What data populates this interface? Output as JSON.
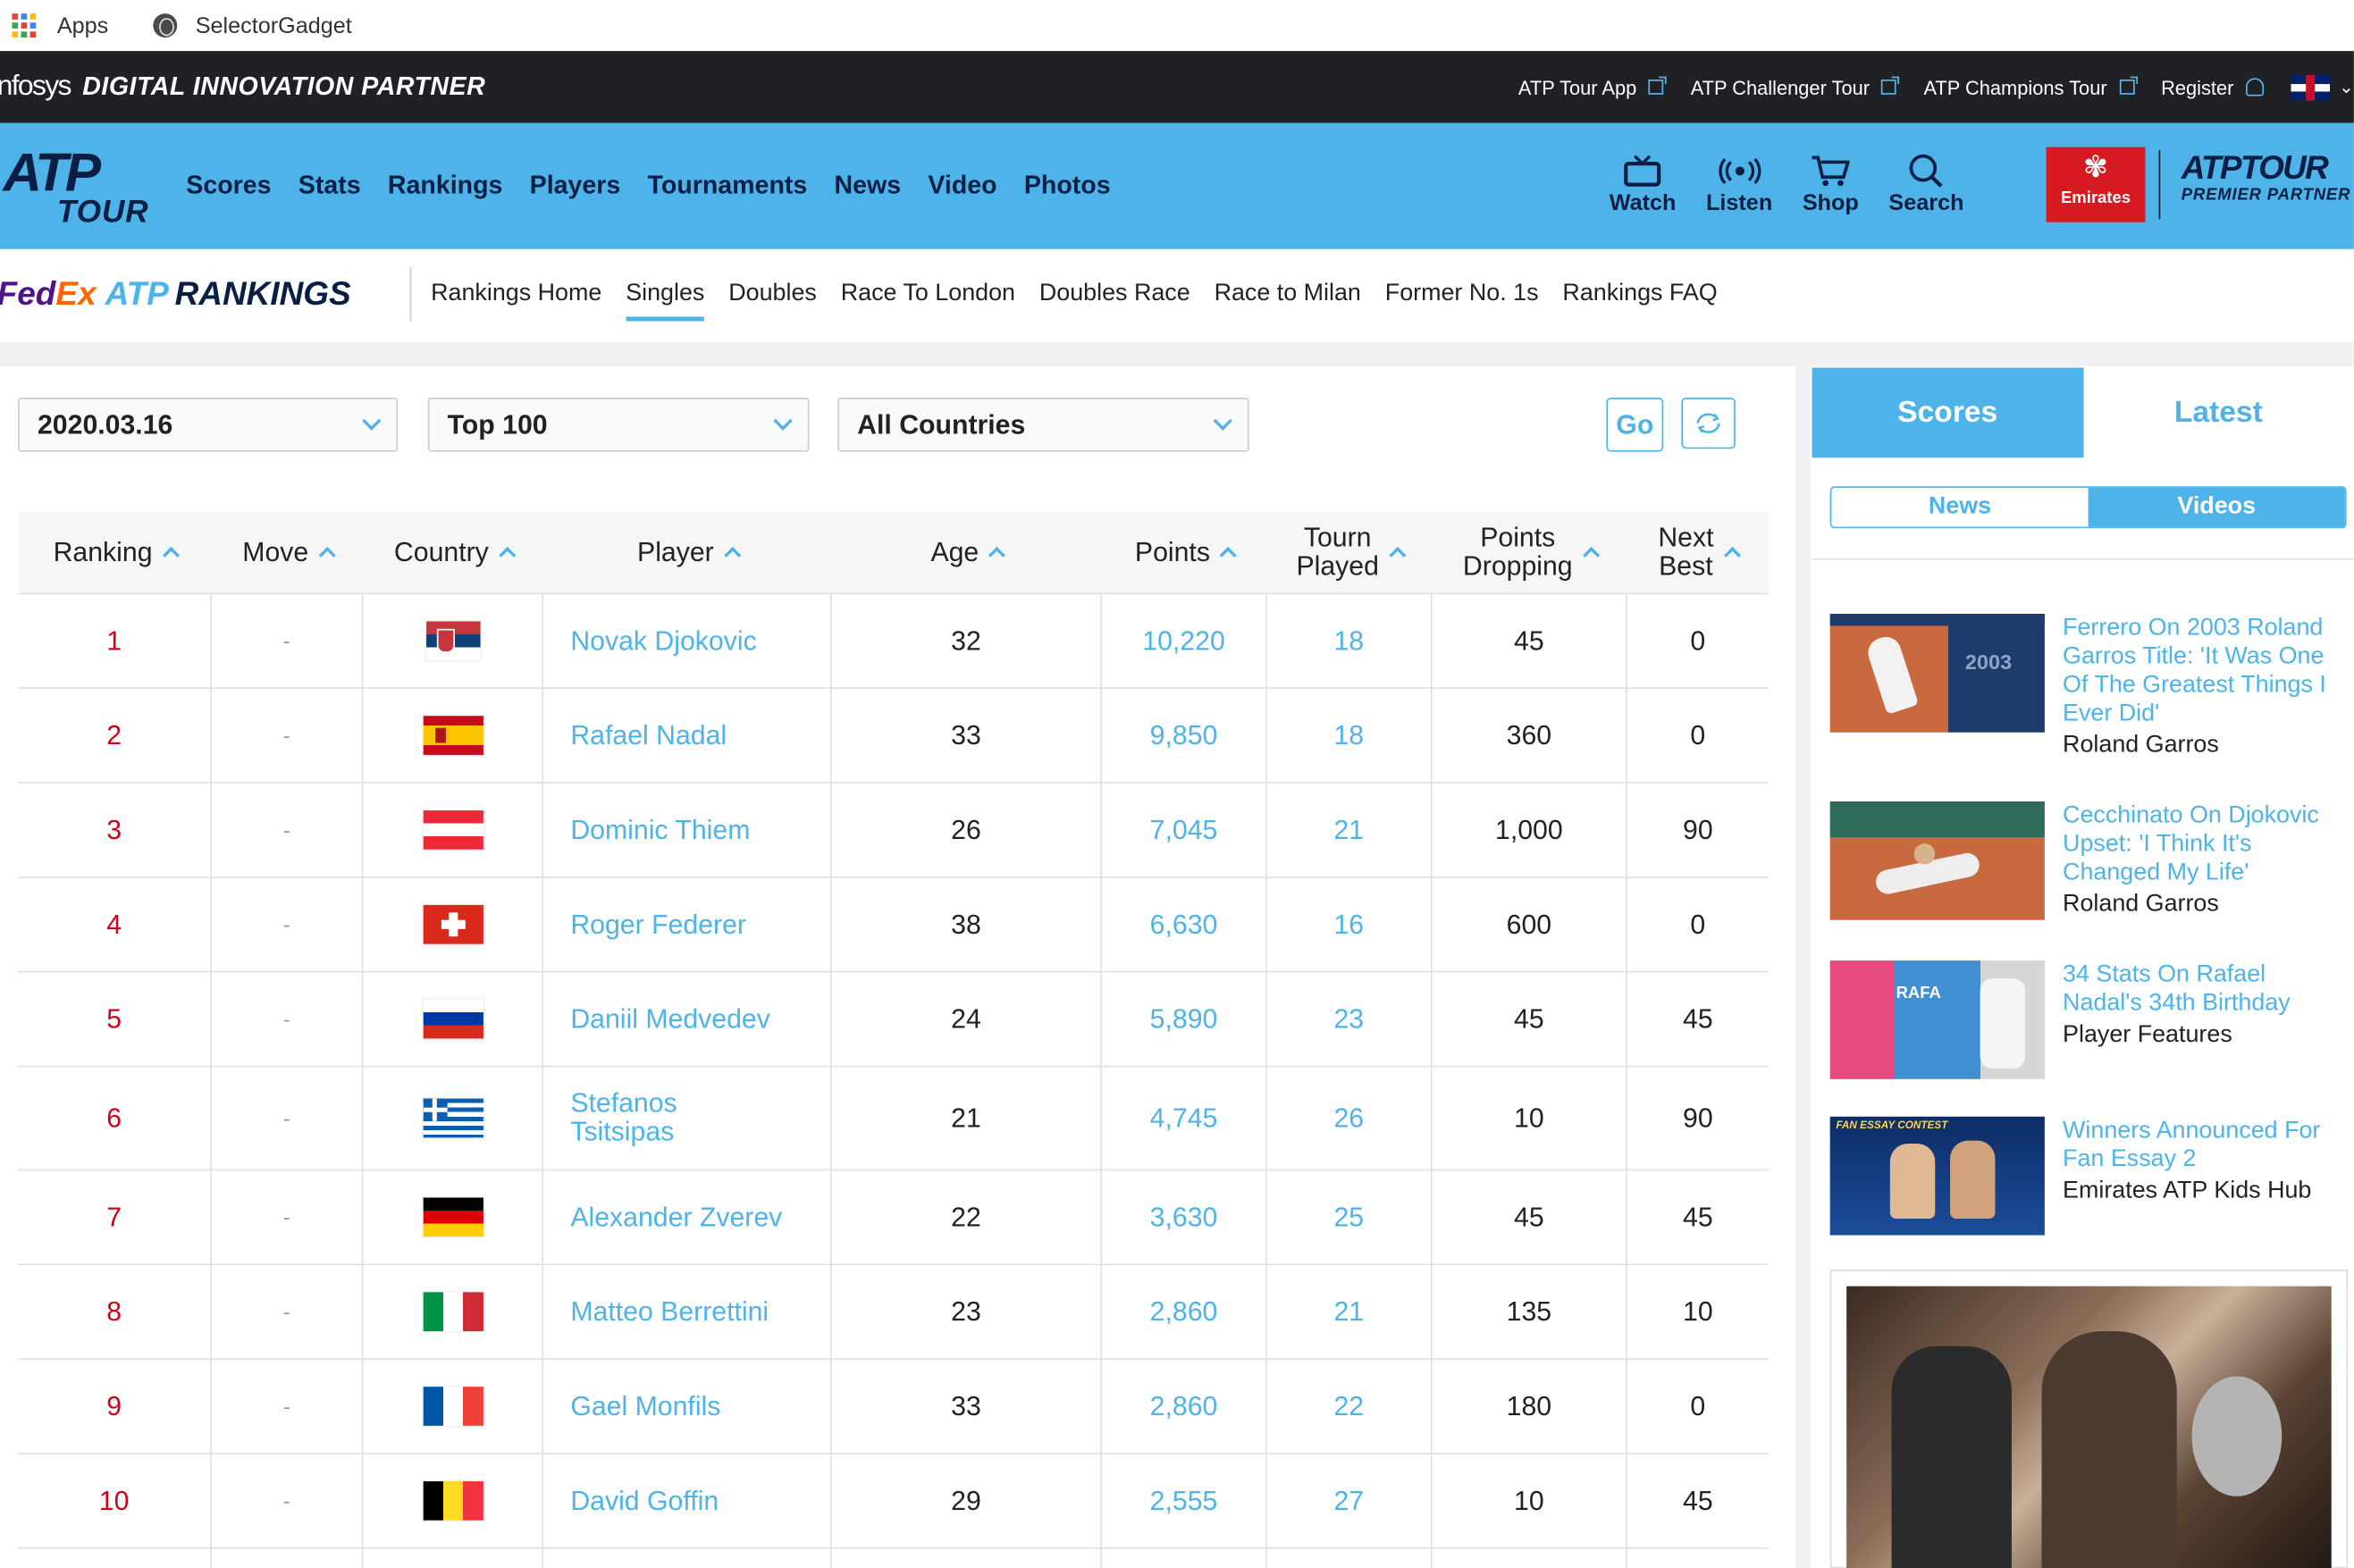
{
  "bookmarks": {
    "apps": "Apps",
    "selector": "SelectorGadget"
  },
  "topbar": {
    "partner_brand": "nfosys",
    "partner_text": "DIGITAL INNOVATION PARTNER",
    "links": [
      "ATP Tour App",
      "ATP Challenger Tour",
      "ATP Champions Tour"
    ],
    "register": "Register"
  },
  "nav": {
    "logo_top": "ATP",
    "logo_bottom": "TOUR",
    "items": [
      "Scores",
      "Stats",
      "Rankings",
      "Players",
      "Tournaments",
      "News",
      "Video",
      "Photos"
    ],
    "tools": [
      "Watch",
      "Listen",
      "Shop",
      "Search"
    ],
    "sponsor": "Emirates",
    "premier_top": "ATPTOUR",
    "premier_bottom": "PREMIER PARTNER"
  },
  "subnav": {
    "fedex_a": "Fed",
    "fedex_b": "Ex",
    "atp": "ATP",
    "rankings": "RANKINGS",
    "items": [
      "Rankings Home",
      "Singles",
      "Doubles",
      "Race To London",
      "Doubles Race",
      "Race to Milan",
      "Former No. 1s",
      "Rankings FAQ"
    ],
    "active": "Singles"
  },
  "filters": {
    "date": "2020.03.16",
    "range": "Top 100",
    "country": "All Countries",
    "go": "Go"
  },
  "table": {
    "headers": {
      "ranking": "Ranking",
      "move": "Move",
      "country": "Country",
      "player": "Player",
      "age": "Age",
      "points": "Points",
      "tourn1": "Tourn",
      "tourn2": "Played",
      "drop1": "Points",
      "drop2": "Dropping",
      "next1": "Next",
      "next2": "Best"
    },
    "rows": [
      {
        "rank": "1",
        "move": "-",
        "player": "Novak Djokovic",
        "age": "32",
        "points": "10,220",
        "played": "18",
        "dropping": "45",
        "next": "0"
      },
      {
        "rank": "2",
        "move": "-",
        "player": "Rafael Nadal",
        "age": "33",
        "points": "9,850",
        "played": "18",
        "dropping": "360",
        "next": "0"
      },
      {
        "rank": "3",
        "move": "-",
        "player": "Dominic Thiem",
        "age": "26",
        "points": "7,045",
        "played": "21",
        "dropping": "1,000",
        "next": "90"
      },
      {
        "rank": "4",
        "move": "-",
        "player": "Roger Federer",
        "age": "38",
        "points": "6,630",
        "played": "16",
        "dropping": "600",
        "next": "0"
      },
      {
        "rank": "5",
        "move": "-",
        "player": "Daniil Medvedev",
        "age": "24",
        "points": "5,890",
        "played": "23",
        "dropping": "45",
        "next": "45"
      },
      {
        "rank": "6",
        "move": "-",
        "player": "Stefanos Tsitsipas",
        "age": "21",
        "points": "4,745",
        "played": "26",
        "dropping": "10",
        "next": "90"
      },
      {
        "rank": "7",
        "move": "-",
        "player": "Alexander Zverev",
        "age": "22",
        "points": "3,630",
        "played": "25",
        "dropping": "45",
        "next": "45"
      },
      {
        "rank": "8",
        "move": "-",
        "player": "Matteo Berrettini",
        "age": "23",
        "points": "2,860",
        "played": "21",
        "dropping": "135",
        "next": "10"
      },
      {
        "rank": "9",
        "move": "-",
        "player": "Gael Monfils",
        "age": "33",
        "points": "2,860",
        "played": "22",
        "dropping": "180",
        "next": "0"
      },
      {
        "rank": "10",
        "move": "-",
        "player": "David Goffin",
        "age": "29",
        "points": "2,555",
        "played": "27",
        "dropping": "10",
        "next": "45"
      }
    ]
  },
  "sidebar": {
    "tabs": [
      "Scores",
      "Latest"
    ],
    "subtabs": [
      "News",
      "Videos"
    ],
    "videos": [
      {
        "title": "Ferrero On 2003 Roland Garros Title: 'It Was One Of The Greatest Things I Ever Did'",
        "category": "Roland Garros"
      },
      {
        "title": "Cecchinato On Djokovic Upset: 'I Think It's Changed My Life'",
        "category": "Roland Garros"
      },
      {
        "title": "34 Stats On Rafael Nadal's 34th Birthday",
        "category": "Player Features"
      },
      {
        "title": "Winners Announced For Fan Essay 2",
        "category": "Emirates ATP Kids Hub"
      }
    ],
    "thumb_texts": {
      "t1": "2003",
      "t3": "RAFA",
      "t4": "FAN ESSAY CONTEST"
    }
  },
  "colors": {
    "accent": "#4db3e9",
    "navy": "#0b1f44",
    "rank_red": "#d0021b",
    "topbar": "#202124"
  }
}
